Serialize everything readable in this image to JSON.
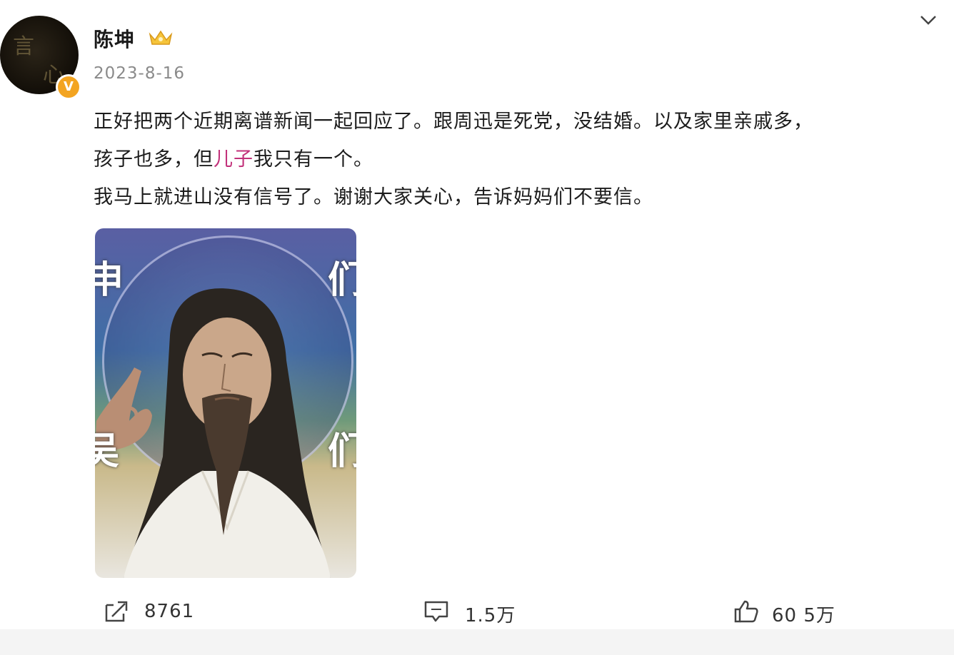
{
  "author": {
    "name": "陈坤",
    "verified_badge": "V",
    "member_icon": "crown-icon"
  },
  "post": {
    "date": "2023-8-16",
    "lines": [
      {
        "before": "正好把两个近期离谱新闻一起回应了。跟周迅是死党，没结婚。以及家里亲戚多，",
        "mention": "",
        "after": ""
      },
      {
        "before": "孩子也多，但",
        "mention": "儿子",
        "after": "我只有一个。"
      },
      {
        "before": "我马上就进山没有信号了。谢谢大家关心，告诉妈妈们不要信。",
        "mention": "",
        "after": ""
      }
    ],
    "image": {
      "left_chars": [
        "申",
        "吴"
      ],
      "right_chars": [
        "们",
        "们"
      ]
    }
  },
  "actions": {
    "repost_count": "8761",
    "comment_count": "1.5万",
    "like_count": "60 5万"
  },
  "colors": {
    "mention": "#c2317a",
    "badge": "#f3a421",
    "date": "#8a8a8a"
  }
}
